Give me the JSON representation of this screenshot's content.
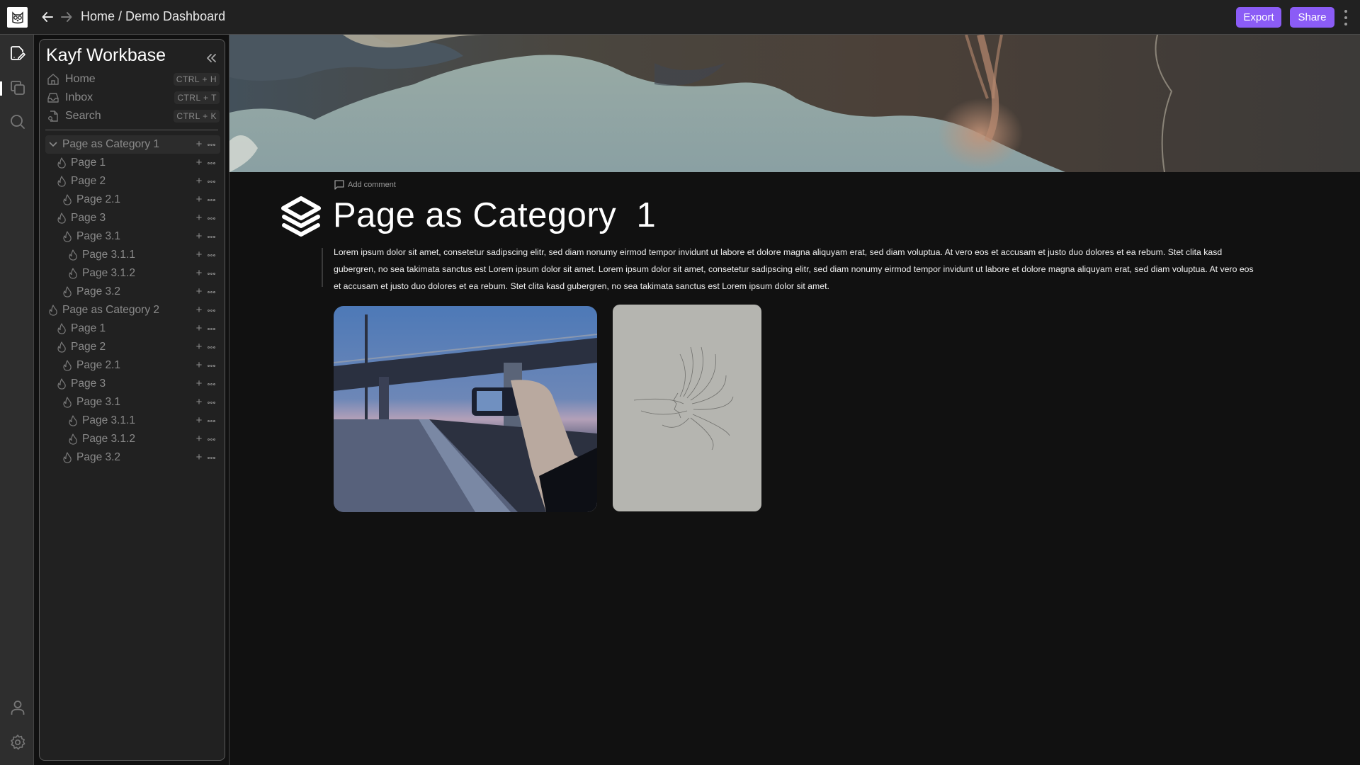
{
  "topbar": {
    "breadcrumb": "Home / Demo Dashboard",
    "export_label": "Export",
    "share_label": "Share",
    "accent_color": "#8b5cf6"
  },
  "rail": {
    "icons": [
      "edit-page-icon",
      "copy-icon",
      "search-icon",
      "user-icon",
      "settings-icon"
    ]
  },
  "sidebar": {
    "workspace_title": "Kayf Workbase",
    "quick_links": [
      {
        "label": "Home",
        "shortcut": "CTRL + H",
        "icon": "home-icon"
      },
      {
        "label": "Inbox",
        "shortcut": "CTRL + T",
        "icon": "inbox-icon"
      },
      {
        "label": "Search",
        "shortcut": "CTRL + K",
        "icon": "search-doc-icon"
      }
    ],
    "tree": [
      {
        "label": "Page as Category 1",
        "depth": 0,
        "expanded": true,
        "selected": true
      },
      {
        "label": "Page 1",
        "depth": 1
      },
      {
        "label": "Page 2",
        "depth": 1
      },
      {
        "label": "Page 2.1",
        "depth": 2
      },
      {
        "label": "Page 3",
        "depth": 1
      },
      {
        "label": "Page 3.1",
        "depth": 2
      },
      {
        "label": "Page 3.1.1",
        "depth": 3
      },
      {
        "label": "Page 3.1.2",
        "depth": 3
      },
      {
        "label": "Page 3.2",
        "depth": 2
      },
      {
        "label": "Page as Category 2",
        "depth": 0
      },
      {
        "label": "Page 1",
        "depth": 1
      },
      {
        "label": "Page 2",
        "depth": 1
      },
      {
        "label": "Page 2.1",
        "depth": 2
      },
      {
        "label": "Page 3",
        "depth": 1
      },
      {
        "label": "Page 3.1",
        "depth": 2
      },
      {
        "label": "Page 3.1.1",
        "depth": 3
      },
      {
        "label": "Page 3.1.2",
        "depth": 3
      },
      {
        "label": "Page 3.2",
        "depth": 2
      }
    ]
  },
  "page": {
    "add_comment": "Add comment",
    "title": "Page as Category  1",
    "body": "Lorem ipsum dolor sit amet, consetetur sadipscing elitr, sed diam nonumy eirmod tempor invidunt ut labore et dolore magna aliquyam erat, sed diam voluptua. At vero eos et accusam et justo duo dolores et ea rebum. Stet clita kasd gubergren, no sea takimata sanctus est Lorem ipsum dolor sit amet. Lorem ipsum dolor sit amet, consetetur sadipscing elitr, sed diam nonumy eirmod tempor invidunt ut labore et dolore magna aliquyam erat, sed diam voluptua. At vero eos et accusam et justo duo dolores et ea rebum. Stet clita kasd gubergren, no sea takimata sanctus est Lorem ipsum dolor sit amet.",
    "images": [
      {
        "name": "photo-bridge-road",
        "description": "person holding phone photographing road under bridge at dusk"
      },
      {
        "name": "pencil-sketch",
        "description": "pencil sketch of face with flowing hair"
      }
    ]
  }
}
